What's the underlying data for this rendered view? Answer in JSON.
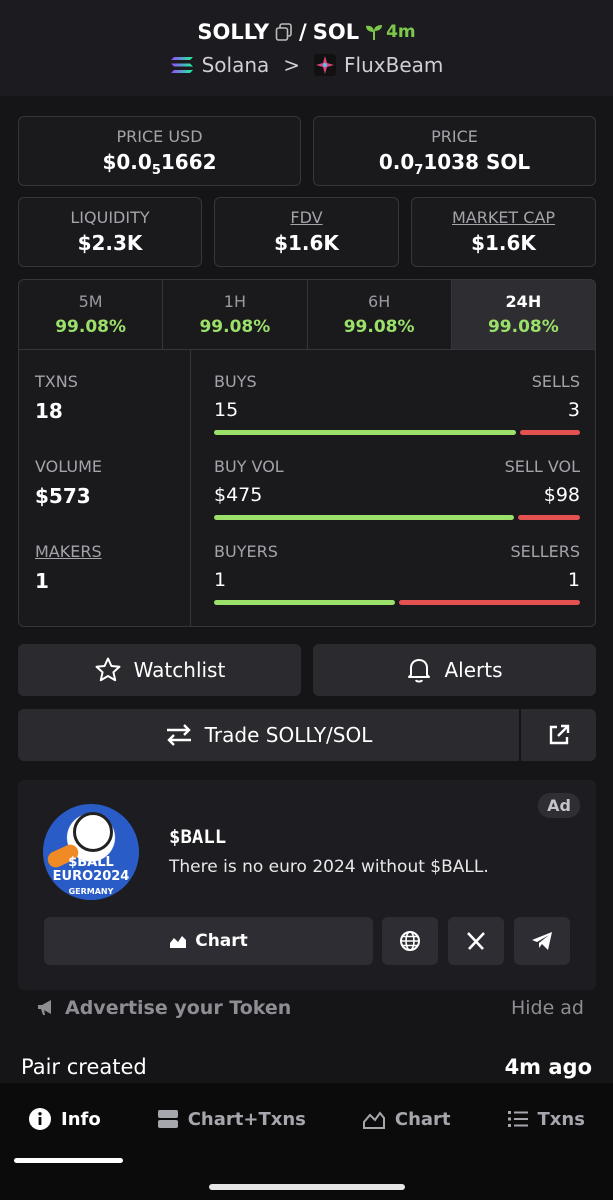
{
  "header": {
    "token": "SOLLY",
    "separator": "/",
    "quote": "SOL",
    "age": "4m",
    "chain": "Solana",
    "chevron": ">",
    "dex": "FluxBeam",
    "icons": {
      "copy": "copy-icon",
      "sprout": "sprout-icon",
      "chain": "solana-logo",
      "dex": "fluxbeam-logo"
    }
  },
  "price_usd": {
    "label": "PRICE USD",
    "prefix": "$0.0",
    "sub": "5",
    "suffix": "1662"
  },
  "price_sol": {
    "label": "PRICE",
    "prefix": "0.0",
    "sub": "7",
    "suffix": "1038 SOL"
  },
  "metrics": [
    {
      "label": "LIQUIDITY",
      "value": "$2.3K"
    },
    {
      "label": "FDV",
      "value": "$1.6K"
    },
    {
      "label": "MARKET CAP",
      "value": "$1.6K"
    }
  ],
  "timeframes": [
    {
      "label": "5M",
      "value": "99.08%"
    },
    {
      "label": "1H",
      "value": "99.08%"
    },
    {
      "label": "6H",
      "value": "99.08%"
    },
    {
      "label": "24H",
      "value": "99.08%",
      "active": true
    }
  ],
  "stats": {
    "txns": {
      "label": "TXNS",
      "value": "18"
    },
    "volume": {
      "label": "VOLUME",
      "value": "$573"
    },
    "makers": {
      "label": "MAKERS",
      "value": "1"
    },
    "buys": {
      "label": "BUYS",
      "value": "15",
      "sell_label": "SELLS",
      "sell_value": "3",
      "buy_share": 0.833
    },
    "vol": {
      "label": "BUY VOL",
      "value": "$475",
      "sell_label": "SELL VOL",
      "sell_value": "$98",
      "buy_share": 0.829
    },
    "buyers": {
      "label": "BUYERS",
      "value": "1",
      "sell_label": "SELLERS",
      "sell_value": "1",
      "buy_share": 0.5
    }
  },
  "actions": {
    "watchlist": "Watchlist",
    "alerts": "Alerts",
    "trade": "Trade SOLLY/SOL",
    "icons": {
      "watchlist": "star-icon",
      "alerts": "bell-icon",
      "trade": "swap-arrows-icon",
      "external": "external-link-icon"
    }
  },
  "ad": {
    "badge": "Ad",
    "title": "$BALL",
    "description": "There is no euro 2024 without $BALL.",
    "logo_text": "$BALL",
    "logo_text2": "EURO2024",
    "logo_text3": "GERMANY",
    "chart_label": "Chart",
    "icons": {
      "chart": "chart-icon",
      "web": "globe-icon",
      "x": "x-logo-icon",
      "telegram": "telegram-icon"
    }
  },
  "advertise": {
    "label": "Advertise your Token",
    "hide": "Hide ad"
  },
  "pair_created": {
    "label": "Pair created",
    "value": "4m ago"
  },
  "nav": [
    {
      "label": "Info",
      "icon": "info-icon",
      "active": true
    },
    {
      "label": "Chart+Txns",
      "icon": "layout-icon"
    },
    {
      "label": "Chart",
      "icon": "chart-icon"
    },
    {
      "label": "Txns",
      "icon": "list-icon"
    }
  ],
  "colors": {
    "bg": "#151517",
    "positive": "#9be06a",
    "negative": "#e35151",
    "accent_green": "#7dc84a"
  }
}
